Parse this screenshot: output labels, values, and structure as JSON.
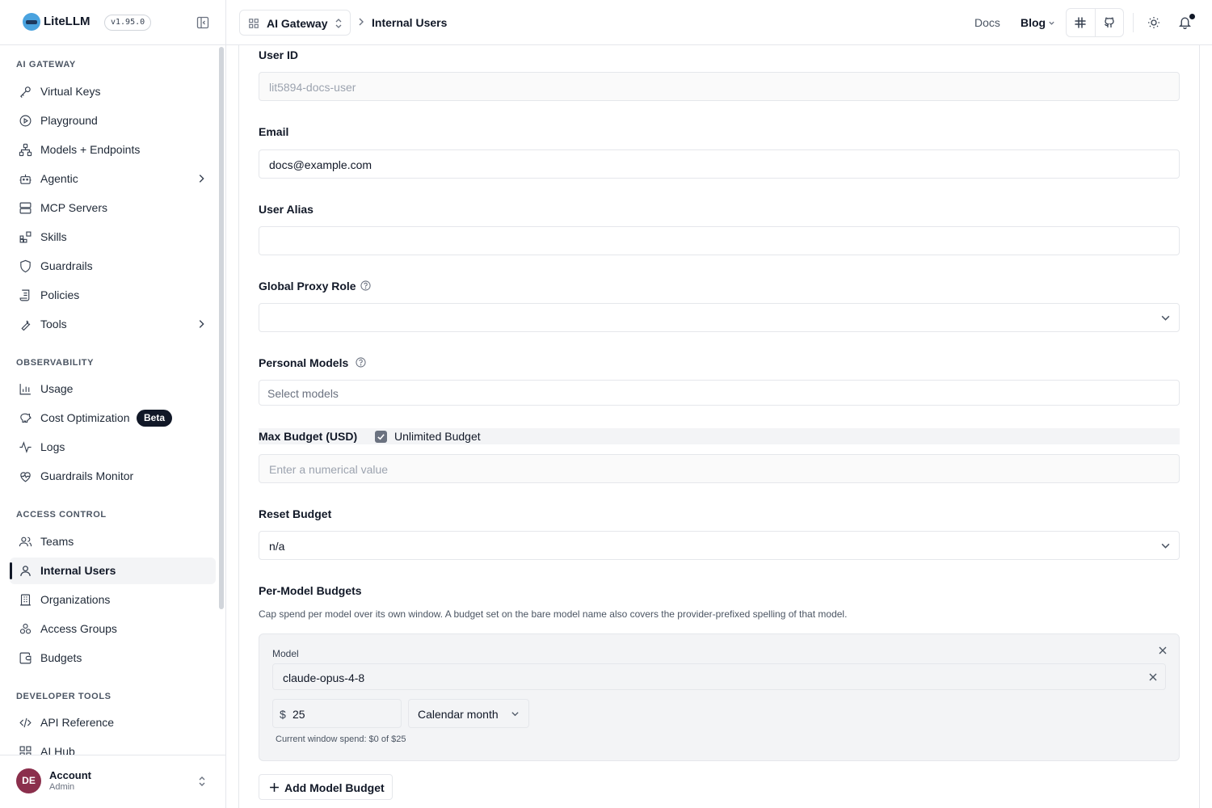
{
  "brand": {
    "name": "LiteLLM",
    "version": "v1.95.0"
  },
  "sidebar": {
    "sections": [
      {
        "title": "AI GATEWAY"
      },
      {
        "title": "OBSERVABILITY"
      },
      {
        "title": "ACCESS CONTROL"
      },
      {
        "title": "DEVELOPER TOOLS"
      }
    ],
    "items": [
      {
        "label": "Virtual Keys",
        "icon": "key-icon"
      },
      {
        "label": "Playground",
        "icon": "play-circle-icon"
      },
      {
        "label": "Models + Endpoints",
        "icon": "network-icon"
      },
      {
        "label": "Agentic",
        "icon": "robot-icon",
        "expandable": true
      },
      {
        "label": "MCP Servers",
        "icon": "server-icon"
      },
      {
        "label": "Skills",
        "icon": "blocks-icon"
      },
      {
        "label": "Guardrails",
        "icon": "shield-icon"
      },
      {
        "label": "Policies",
        "icon": "scroll-icon"
      },
      {
        "label": "Tools",
        "icon": "wrench-icon",
        "expandable": true
      },
      {
        "label": "Usage",
        "icon": "bar-chart-icon"
      },
      {
        "label": "Cost Optimization",
        "icon": "piggy-bank-icon",
        "badge": "Beta"
      },
      {
        "label": "Logs",
        "icon": "activity-icon"
      },
      {
        "label": "Guardrails Monitor",
        "icon": "heart-pulse-icon"
      },
      {
        "label": "Teams",
        "icon": "users-icon"
      },
      {
        "label": "Internal Users",
        "icon": "user-icon",
        "active": true
      },
      {
        "label": "Organizations",
        "icon": "building-icon"
      },
      {
        "label": "Access Groups",
        "icon": "group-icon"
      },
      {
        "label": "Budgets",
        "icon": "wallet-icon"
      },
      {
        "label": "API Reference",
        "icon": "code-icon"
      },
      {
        "label": "AI Hub",
        "icon": "grid-icon"
      }
    ]
  },
  "account": {
    "initials": "DE",
    "name": "Account",
    "role": "Admin"
  },
  "topbar": {
    "gateway": "AI Gateway",
    "breadcrumb": "Internal Users",
    "docs": "Docs",
    "blog": "Blog"
  },
  "form": {
    "user_id": {
      "label": "User ID",
      "value": "lit5894-docs-user"
    },
    "email": {
      "label": "Email",
      "value": "docs@example.com"
    },
    "user_alias": {
      "label": "User Alias",
      "value": ""
    },
    "global_proxy_role": {
      "label": "Global Proxy Role",
      "value": ""
    },
    "personal_models": {
      "label": "Personal Models",
      "placeholder": "Select models"
    },
    "max_budget": {
      "label": "Max Budget (USD)",
      "unlimited_label": "Unlimited Budget",
      "unlimited_checked": true,
      "placeholder": "Enter a numerical value"
    },
    "reset_budget": {
      "label": "Reset Budget",
      "value": "n/a"
    },
    "per_model": {
      "label": "Per-Model Budgets",
      "helper": "Cap spend per model over its own window. A budget set on the bare model name also covers the provider-prefixed spelling of that model.",
      "entries": [
        {
          "model_label": "Model",
          "model": "claude-opus-4-8",
          "currency": "$",
          "amount": "25",
          "window": "Calendar month",
          "spend": "Current window spend: $0 of $25"
        }
      ],
      "add_label": "Add Model Budget"
    }
  }
}
